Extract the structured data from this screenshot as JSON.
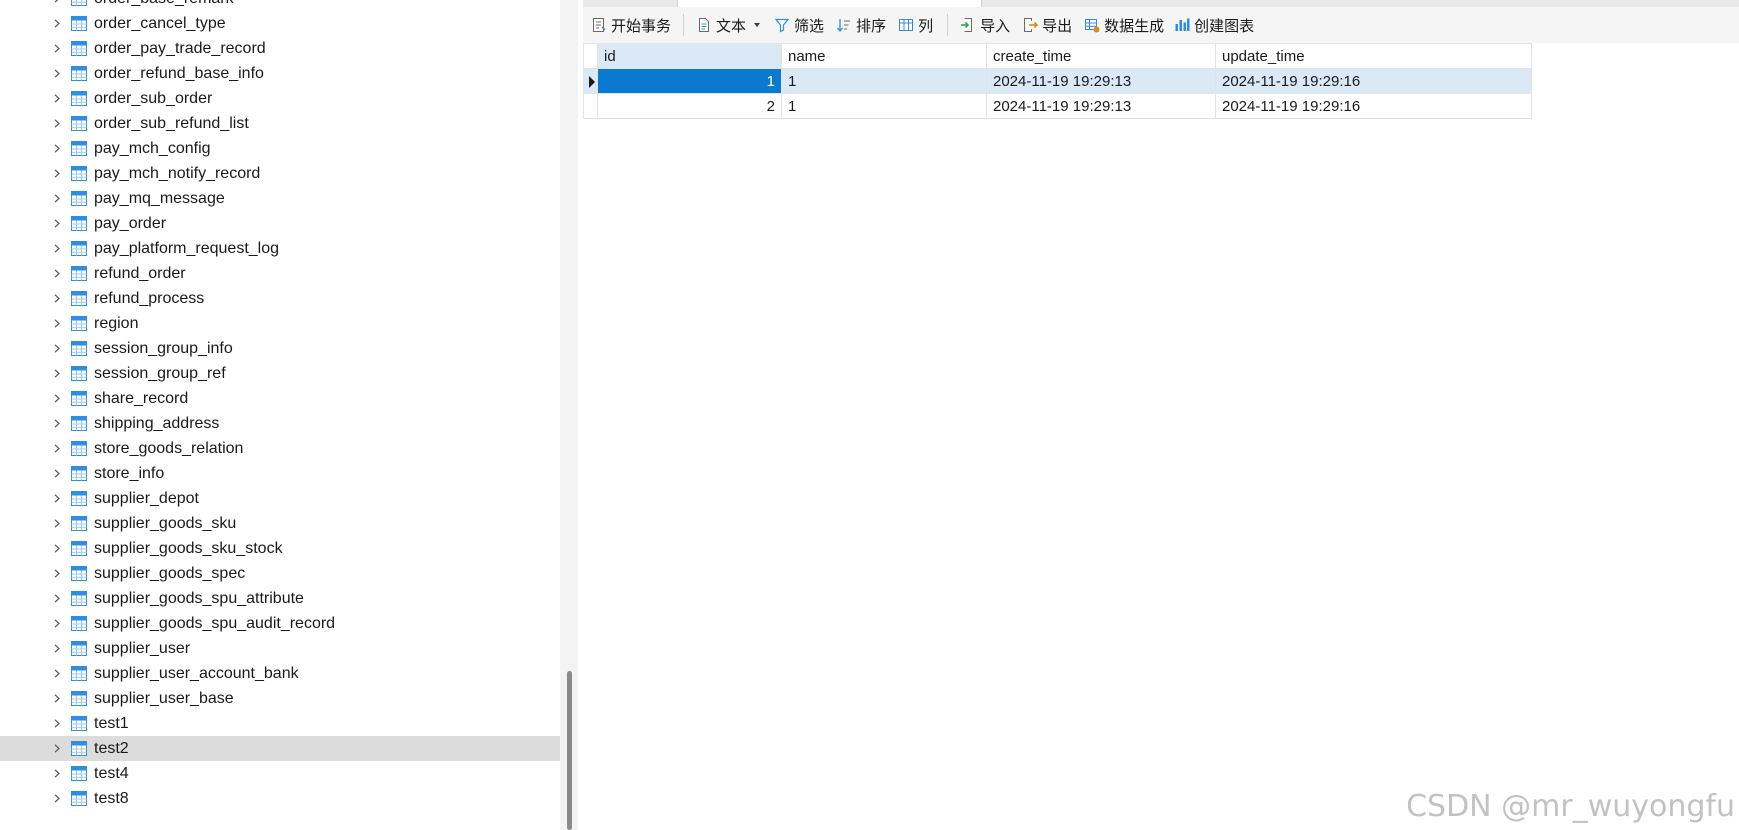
{
  "tree": {
    "items": [
      {
        "label": "order_base_remark"
      },
      {
        "label": "order_cancel_type"
      },
      {
        "label": "order_pay_trade_record"
      },
      {
        "label": "order_refund_base_info"
      },
      {
        "label": "order_sub_order"
      },
      {
        "label": "order_sub_refund_list"
      },
      {
        "label": "pay_mch_config"
      },
      {
        "label": "pay_mch_notify_record"
      },
      {
        "label": "pay_mq_message"
      },
      {
        "label": "pay_order"
      },
      {
        "label": "pay_platform_request_log"
      },
      {
        "label": "refund_order"
      },
      {
        "label": "refund_process"
      },
      {
        "label": "region"
      },
      {
        "label": "session_group_info"
      },
      {
        "label": "session_group_ref"
      },
      {
        "label": "share_record"
      },
      {
        "label": "shipping_address"
      },
      {
        "label": "store_goods_relation"
      },
      {
        "label": "store_info"
      },
      {
        "label": "supplier_depot"
      },
      {
        "label": "supplier_goods_sku"
      },
      {
        "label": "supplier_goods_sku_stock"
      },
      {
        "label": "supplier_goods_spec"
      },
      {
        "label": "supplier_goods_spu_attribute"
      },
      {
        "label": "supplier_goods_spu_audit_record"
      },
      {
        "label": "supplier_user"
      },
      {
        "label": "supplier_user_account_bank"
      },
      {
        "label": "supplier_user_base"
      },
      {
        "label": "test1"
      },
      {
        "label": "test2",
        "selected": true
      },
      {
        "label": "test4"
      },
      {
        "label": "test8"
      }
    ]
  },
  "toolbar": {
    "begin_transaction": "开始事务",
    "text": "文本",
    "filter": "筛选",
    "sort": "排序",
    "columns": "列",
    "import": "导入",
    "export": "导出",
    "data_generation": "数据生成",
    "create_chart": "创建图表"
  },
  "grid": {
    "columns": [
      "id",
      "name",
      "create_time",
      "update_time"
    ],
    "rows": [
      [
        "1",
        "1",
        "2024-11-19 19:29:13",
        "2024-11-19 19:29:16"
      ],
      [
        "2",
        "1",
        "2024-11-19 19:29:13",
        "2024-11-19 19:29:16"
      ]
    ]
  },
  "watermark": "CSDN @mr_wuyongfu",
  "colors": {
    "selection": "#0b79d0",
    "row_highlight": "#dbe8f6",
    "tree_selected": "#dcdcdc",
    "table_icon": "#2f8ee0"
  }
}
